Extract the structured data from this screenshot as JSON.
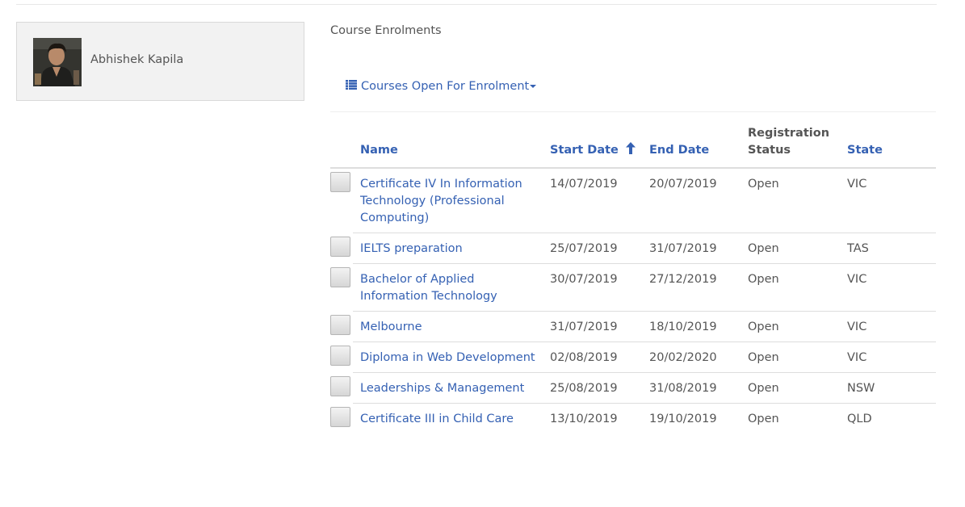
{
  "profile": {
    "name": "Abhishek Kapila"
  },
  "section_title": "Course Enrolments",
  "menu": {
    "label": "Courses Open For Enrolment"
  },
  "table": {
    "headers": {
      "name": "Name",
      "start": "Start Date",
      "end": "End Date",
      "reg_line1": "Registration",
      "reg_line2": "Status",
      "state": "State"
    },
    "rows": [
      {
        "name": "Certificate IV In Information Technology (Professional Computing)",
        "start": "14/07/2019",
        "end": "20/07/2019",
        "status": "Open",
        "state": "VIC"
      },
      {
        "name": "IELTS preparation",
        "start": "25/07/2019",
        "end": "31/07/2019",
        "status": "Open",
        "state": "TAS"
      },
      {
        "name": "Bachelor of Applied Information Technology",
        "start": "30/07/2019",
        "end": "27/12/2019",
        "status": "Open",
        "state": "VIC"
      },
      {
        "name": "Melbourne",
        "start": "31/07/2019",
        "end": "18/10/2019",
        "status": "Open",
        "state": "VIC"
      },
      {
        "name": "Diploma in Web Development",
        "start": "02/08/2019",
        "end": "20/02/2020",
        "status": "Open",
        "state": "VIC"
      },
      {
        "name": "Leaderships & Management",
        "start": "25/08/2019",
        "end": "31/08/2019",
        "status": "Open",
        "state": "NSW"
      },
      {
        "name": "Certificate III in Child Care",
        "start": "13/10/2019",
        "end": "19/10/2019",
        "status": "Open",
        "state": "QLD"
      }
    ]
  },
  "colors": {
    "link": "#3561b3",
    "text": "#555555",
    "panel": "#f2f2f2"
  },
  "icons": {
    "menu": "list-icon",
    "sort": "sort-ascending-arrow-icon",
    "toggle": "caret-down-icon"
  }
}
